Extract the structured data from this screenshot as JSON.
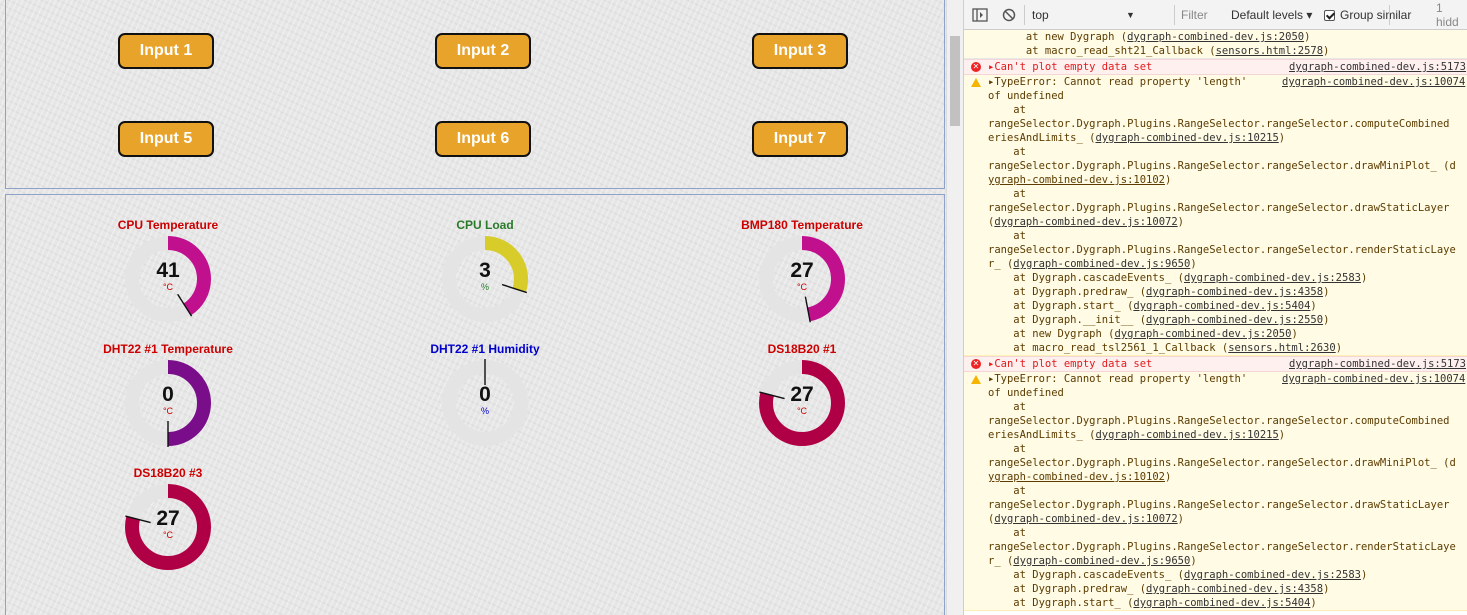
{
  "inputs": {
    "buttons": [
      {
        "label": "Input 1"
      },
      {
        "label": "Input 2"
      },
      {
        "label": "Input 3"
      },
      {
        "label": "Input 5"
      },
      {
        "label": "Input 6"
      },
      {
        "label": "Input 7"
      }
    ],
    "button_color": "#e8a32a"
  },
  "gauges": [
    {
      "title": "CPU Temperature",
      "value": "41",
      "unit": "°C",
      "fraction": 0.41,
      "title_color": "#cc0000",
      "unit_color": "#cc0000",
      "arc_color": "#c0108e"
    },
    {
      "title": "CPU Load",
      "value": "3",
      "unit": "%",
      "fraction": 0.3,
      "title_color": "#2a7a2a",
      "unit_color": "#2a7a2a",
      "arc_color": "#d8cc2a"
    },
    {
      "title": "BMP180 Temperature",
      "value": "27",
      "unit": "°C",
      "fraction": 0.47,
      "title_color": "#cc0000",
      "unit_color": "#cc0000",
      "arc_color": "#c0108e"
    },
    {
      "title": "DHT22 #1 Temperature",
      "value": "0",
      "unit": "°C",
      "fraction": 0.5,
      "title_color": "#cc0000",
      "unit_color": "#cc0000",
      "arc_color": "#7a0e8a"
    },
    {
      "title": "DHT22 #1 Humidity",
      "value": "0",
      "unit": "%",
      "fraction": 0.0,
      "title_color": "#0000cc",
      "unit_color": "#0000cc",
      "arc_color": "#0000cc"
    },
    {
      "title": "DS18B20 #1",
      "value": "27",
      "unit": "°C",
      "fraction": 0.79,
      "title_color": "#cc0000",
      "unit_color": "#cc0000",
      "arc_color": "#b00045"
    },
    {
      "title": "DS18B20 #3",
      "value": "27",
      "unit": "°C",
      "fraction": 0.79,
      "title_color": "#cc0000",
      "unit_color": "#cc0000",
      "arc_color": "#b00045"
    }
  ],
  "devtools": {
    "context": "top",
    "filter_placeholder": "Filter",
    "levels": "Default levels ▾",
    "group_similar": "Group similar",
    "hidden": "1 hidd",
    "messages": [
      {
        "kind": "plain",
        "lines": [
          {
            "text": "      at new Dygraph (",
            "link": "dygraph-combined-dev.js:2050",
            "tail": ")"
          },
          {
            "text": "      at macro_read_sht21_Callback (",
            "link": "sensors.html:2578",
            "tail": ")"
          }
        ]
      },
      {
        "kind": "error",
        "lines": [
          {
            "text": "▸Can't plot empty data set",
            "src": "dygraph-combined-dev.js:5173"
          }
        ]
      },
      {
        "kind": "warn",
        "lines": [
          {
            "text": "▸TypeError: Cannot read property 'length'",
            "src": "dygraph-combined-dev.js:10074"
          },
          {
            "text": "of undefined"
          },
          {
            "text": "    at"
          },
          {
            "text": "rangeSelector.Dygraph.Plugins.RangeSelector.rangeSelector.computeCombined"
          },
          {
            "text": "eriesAndLimits_ (",
            "link": "dygraph-combined-dev.js:10215",
            "tail": ")"
          },
          {
            "text": "    at"
          },
          {
            "text": "rangeSelector.Dygraph.Plugins.RangeSelector.rangeSelector.drawMiniPlot_ (d"
          },
          {
            "text": "ygraph-combined-dev.js:10102",
            "tail": ")",
            "underline_text": true
          },
          {
            "text": "    at"
          },
          {
            "text": "rangeSelector.Dygraph.Plugins.RangeSelector.rangeSelector.drawStaticLayer"
          },
          {
            "text": "(",
            "link": "dygraph-combined-dev.js:10072",
            "tail": ")"
          },
          {
            "text": "    at"
          },
          {
            "text": "rangeSelector.Dygraph.Plugins.RangeSelector.rangeSelector.renderStaticLaye"
          },
          {
            "text": "r_ (",
            "link": "dygraph-combined-dev.js:9650",
            "tail": ")"
          },
          {
            "text": "    at Dygraph.cascadeEvents_ (",
            "link": "dygraph-combined-dev.js:2583",
            "tail": ")"
          },
          {
            "text": "    at Dygraph.predraw_ (",
            "link": "dygraph-combined-dev.js:4358",
            "tail": ")"
          },
          {
            "text": "    at Dygraph.start_ (",
            "link": "dygraph-combined-dev.js:5404",
            "tail": ")"
          },
          {
            "text": "    at Dygraph.__init__ (",
            "link": "dygraph-combined-dev.js:2550",
            "tail": ")"
          },
          {
            "text": "    at new Dygraph (",
            "link": "dygraph-combined-dev.js:2050",
            "tail": ")"
          },
          {
            "text": "    at macro_read_tsl2561_1_Callback (",
            "link": "sensors.html:2630",
            "tail": ")"
          }
        ]
      },
      {
        "kind": "error",
        "lines": [
          {
            "text": "▸Can't plot empty data set",
            "src": "dygraph-combined-dev.js:5173"
          }
        ]
      },
      {
        "kind": "warn",
        "lines": [
          {
            "text": "▸TypeError: Cannot read property 'length'",
            "src": "dygraph-combined-dev.js:10074"
          },
          {
            "text": "of undefined"
          },
          {
            "text": "    at"
          },
          {
            "text": "rangeSelector.Dygraph.Plugins.RangeSelector.rangeSelector.computeCombined"
          },
          {
            "text": "eriesAndLimits_ (",
            "link": "dygraph-combined-dev.js:10215",
            "tail": ")"
          },
          {
            "text": "    at"
          },
          {
            "text": "rangeSelector.Dygraph.Plugins.RangeSelector.rangeSelector.drawMiniPlot_ (d"
          },
          {
            "text": "ygraph-combined-dev.js:10102",
            "tail": ")",
            "underline_text": true
          },
          {
            "text": "    at"
          },
          {
            "text": "rangeSelector.Dygraph.Plugins.RangeSelector.rangeSelector.drawStaticLayer"
          },
          {
            "text": "(",
            "link": "dygraph-combined-dev.js:10072",
            "tail": ")"
          },
          {
            "text": "    at"
          },
          {
            "text": "rangeSelector.Dygraph.Plugins.RangeSelector.rangeSelector.renderStaticLaye"
          },
          {
            "text": "r_ (",
            "link": "dygraph-combined-dev.js:9650",
            "tail": ")"
          },
          {
            "text": "    at Dygraph.cascadeEvents_ (",
            "link": "dygraph-combined-dev.js:2583",
            "tail": ")"
          },
          {
            "text": "    at Dygraph.predraw_ (",
            "link": "dygraph-combined-dev.js:4358",
            "tail": ")"
          },
          {
            "text": "    at Dygraph.start_ (",
            "link": "dygraph-combined-dev.js:5404",
            "tail": ")"
          }
        ]
      }
    ]
  }
}
